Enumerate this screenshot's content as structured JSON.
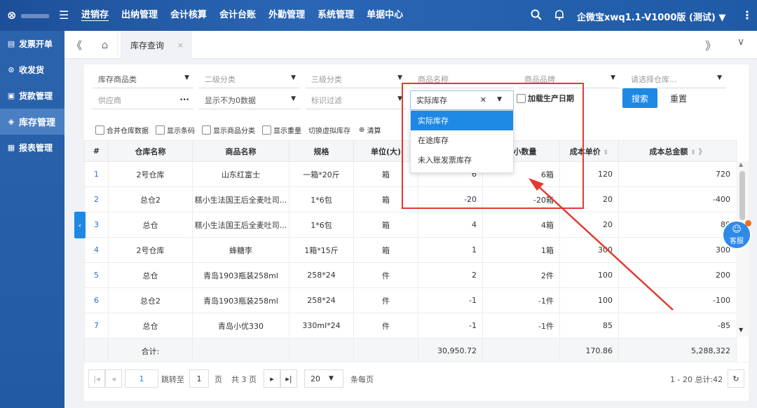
{
  "topbar": {
    "logo_icon": "app-logo-icon",
    "menu_icon": "hamburger-icon",
    "nav": [
      "进销存",
      "出纳管理",
      "会计核算",
      "会计台账",
      "外勤管理",
      "系统管理",
      "单据中心"
    ],
    "active_nav": "进销存",
    "user": "企微宝xwq1.1-V1000版 (测试)",
    "user_caret": "▼",
    "more": "⋮"
  },
  "sidebar": {
    "items": [
      {
        "icon": "invoice-icon",
        "label": "发票开单"
      },
      {
        "icon": "delivery-icon",
        "label": "收发货"
      },
      {
        "icon": "payment-icon",
        "label": "货款管理"
      },
      {
        "icon": "inventory-icon",
        "label": "库存管理"
      },
      {
        "icon": "report-icon",
        "label": "报表管理"
      }
    ],
    "active": "库存管理"
  },
  "tabs": {
    "collapse": "《",
    "home_icon": "home-icon",
    "active_label": "库存查询",
    "close": "×",
    "right": "》",
    "down": "∨"
  },
  "filters": {
    "row1": [
      "库存商品类",
      "二级分类",
      "三级分类",
      "商品名称",
      "商品品牌",
      "请选择仓库..."
    ],
    "row2": [
      "供应商",
      "显示不为0数据",
      "标识过滤"
    ],
    "dots": "···",
    "stock_type_value": "实际库存",
    "stock_type_options": [
      "实际库存",
      "在途库存",
      "未入账发票库存"
    ],
    "production_date_label": "加载生产日期",
    "search_label": "搜索",
    "reset_label": "重置"
  },
  "options": {
    "checkboxes": [
      "合并仓库数据",
      "显示条码",
      "显示商品分类",
      "显示重量"
    ],
    "link": "切换虚拟库存",
    "clear": "清算"
  },
  "table": {
    "columns": [
      "#",
      "仓库名称",
      "商品名称",
      "规格",
      "单位(大)",
      "",
      "大小数量",
      "成本单价",
      "成本总金额"
    ],
    "rows": [
      [
        "1",
        "2号仓库",
        "山东红富士",
        "一箱*20斤",
        "箱",
        "6",
        "6箱",
        "120",
        "720"
      ],
      [
        "2",
        "总仓2",
        "糕小生法国王后全麦吐司...",
        "1*6包",
        "箱",
        "-20",
        "-20箱",
        "20",
        "-400"
      ],
      [
        "3",
        "总仓",
        "糕小生法国王后全麦吐司...",
        "1*6包",
        "箱",
        "4",
        "4箱",
        "20",
        "80"
      ],
      [
        "4",
        "2号仓库",
        "蜂糖李",
        "1箱*15斤",
        "箱",
        "1",
        "1箱",
        "300",
        "300"
      ],
      [
        "5",
        "总仓",
        "青岛1903瓶装258ml",
        "258*24",
        "件",
        "2",
        "2件",
        "100",
        "200"
      ],
      [
        "6",
        "总仓2",
        "青岛1903瓶装258ml",
        "258*24",
        "件",
        "-1",
        "-1件",
        "100",
        "-100"
      ],
      [
        "7",
        "总仓",
        "青岛小优330",
        "330ml*24",
        "件",
        "-1",
        "-1件",
        "85",
        "-85"
      ]
    ],
    "total": {
      "label": "合计:",
      "qty": "30,950.72",
      "unit_cost": "170.86",
      "total_cost": "5,288,322"
    }
  },
  "pager": {
    "page": "1",
    "jump_label": "跳转至",
    "jump_page": "1",
    "page_suffix": "页",
    "total_pages": "共 3 页",
    "page_size": "20",
    "per_page": "条每页",
    "summary": "1 - 20 总计:42"
  },
  "service": {
    "label": "客服"
  },
  "colors": {
    "accent": "#1e88e5",
    "highlight": "#e23a2e",
    "topbar": "#1f5aa6"
  }
}
